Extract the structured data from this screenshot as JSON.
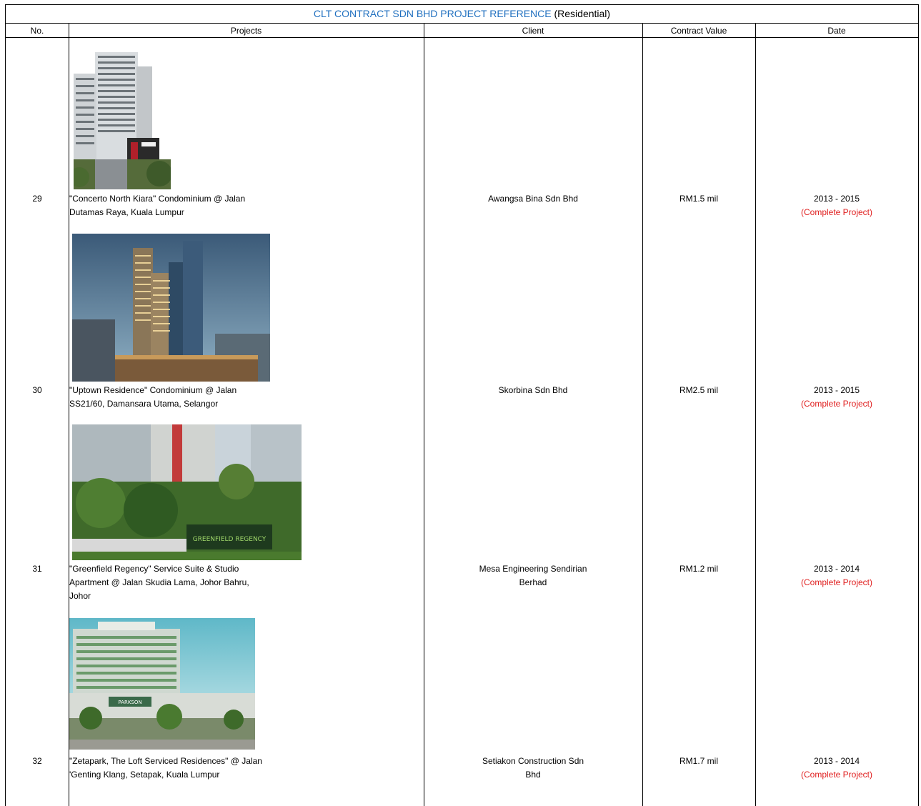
{
  "title": {
    "main": "CLT CONTRACT SDN BHD PROJECT REFERENCE",
    "suffix": "(Residential)"
  },
  "colors": {
    "title_blue": "#1f6fbf",
    "status_red": "#e02020"
  },
  "columns": [
    "No.",
    "Projects",
    "Client",
    "Contract Value",
    "Date"
  ],
  "rows": [
    {
      "no": "29",
      "project_l1": "\"Concerto North Kiara\" Condominium @ Jalan",
      "project_l2": "Dutamas Raya, Kuala Lumpur",
      "project_l3": "",
      "client_l1": "Awangsa Bina Sdn Bhd",
      "client_l2": "",
      "value": "RM1.5 mil",
      "date": "2013 - 2015",
      "status": "(Complete Project)"
    },
    {
      "no": "30",
      "project_l1": "\"Uptown Residence\" Condominium @ Jalan",
      "project_l2": "SS21/60, Damansara Utama, Selangor",
      "project_l3": "",
      "client_l1": "Skorbina Sdn Bhd",
      "client_l2": "",
      "value": "RM2.5 mil",
      "date": "2013 - 2015",
      "status": "(Complete Project)"
    },
    {
      "no": "31",
      "project_l1": "\"Greenfield Regency\" Service Suite & Studio",
      "project_l2": "Apartment @ Jalan Skudia Lama, Johor Bahru,",
      "project_l3": "Johor",
      "client_l1": "Mesa Engineering Sendirian",
      "client_l2": "Berhad",
      "value": "RM1.2 mil",
      "date": "2013 - 2014",
      "status": "(Complete Project)"
    },
    {
      "no": "32",
      "project_l1": "\"Zetapark, The Loft Serviced Residences\" @ Jalan",
      "project_l2": "'Genting Klang, Setapak, Kuala Lumpur",
      "project_l3": "",
      "client_l1": "Setiakon  Construction Sdn",
      "client_l2": "Bhd",
      "value": "RM1.7 mil",
      "date": "2013 - 2014",
      "status": "(Complete Project)"
    }
  ],
  "photo_signs": {
    "greenfield": "GREENFIELD REGENCY",
    "parkson": "PARKSON"
  }
}
